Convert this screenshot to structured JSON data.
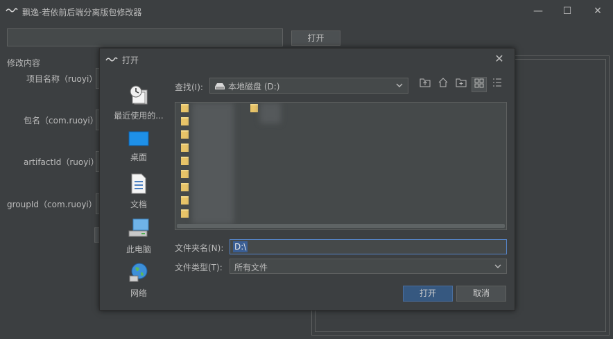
{
  "window": {
    "title": "飘逸-若依前后端分离版包修改器",
    "controls": {
      "minimize": "—",
      "maximize": "☐",
      "close": "✕"
    }
  },
  "main": {
    "open_button": "打开",
    "section_label": "修改内容",
    "fields": [
      {
        "label": "项目名称（ruoyi）"
      },
      {
        "label": "包名（com.ruoyi）"
      },
      {
        "label": "artifactId（ruoyi）"
      },
      {
        "label": "groupId（com.ruoyi）"
      }
    ]
  },
  "dialog": {
    "title": "打开",
    "look_in_label": "查找(I):",
    "look_in_value": "本地磁盘 (D:)",
    "toolbar": [
      "up-folder-icon",
      "home-icon",
      "new-folder-icon",
      "list-view-icon",
      "details-view-icon"
    ],
    "places": [
      {
        "label": "最近使用的..."
      },
      {
        "label": "桌面"
      },
      {
        "label": "文档"
      },
      {
        "label": "此电脑"
      },
      {
        "label": "网络"
      }
    ],
    "folder_name_label": "文件夹名(N):",
    "folder_name_value": "D:\\",
    "file_type_label": "文件类型(T):",
    "file_type_value": "所有文件",
    "open_button": "打开",
    "cancel_button": "取消"
  },
  "colors": {
    "background": "#3c3f41",
    "field": "#45494a",
    "border": "#5e6060",
    "primary_button": "#365880",
    "selection": "#3a5e94",
    "folder": "#e8c468"
  }
}
